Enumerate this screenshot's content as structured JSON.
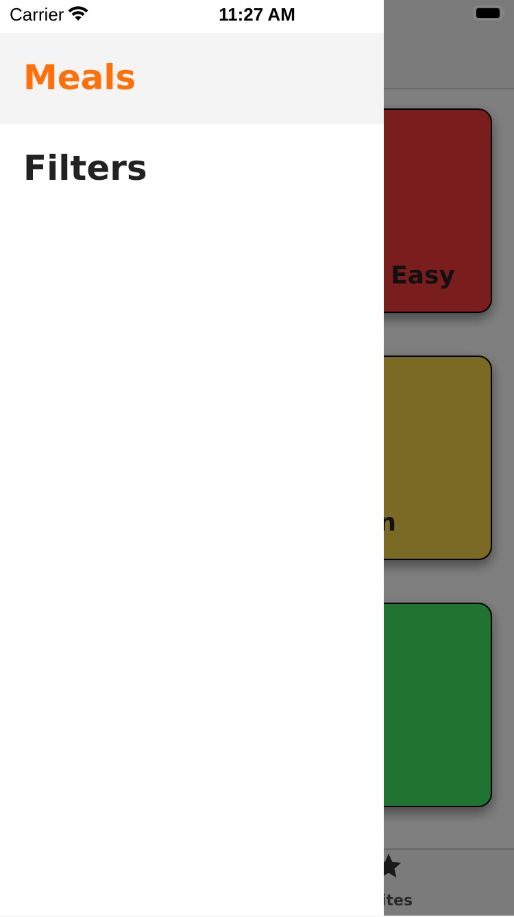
{
  "status_bar": {
    "carrier": "Carrier",
    "time": "11:27 AM"
  },
  "drawer": {
    "items": [
      {
        "label": "Meals",
        "active": true
      },
      {
        "label": "Filters",
        "active": false
      }
    ],
    "active_color": "#ff7009"
  },
  "background": {
    "tiles": [
      {
        "title_visible": "& Easy",
        "color": "#f23a3a"
      },
      {
        "title_visible": "n",
        "color": "#f6d548"
      },
      {
        "title_visible": "",
        "color": "#43e762"
      }
    ],
    "tab": {
      "label_visible": "orites",
      "icon": "star-icon"
    }
  }
}
